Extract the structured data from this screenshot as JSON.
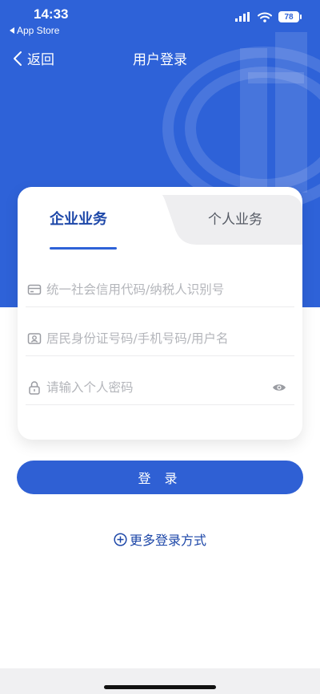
{
  "status_bar": {
    "time": "14:33",
    "back_app": "App Store",
    "battery": "78",
    "icons": [
      "signal-icon",
      "wifi-icon",
      "battery-icon"
    ]
  },
  "nav": {
    "back_label": "返回",
    "title": "用户登录"
  },
  "tabs": [
    {
      "label": "企业业务",
      "active": true
    },
    {
      "label": "个人业务",
      "active": false
    }
  ],
  "fields": {
    "credit_code": {
      "placeholder": "统一社会信用代码/纳税人识别号",
      "value": ""
    },
    "id_number": {
      "placeholder": "居民身份证号码/手机号码/用户名",
      "value": ""
    },
    "password": {
      "placeholder": "请输入个人密码",
      "value": ""
    }
  },
  "login_button": "登 录",
  "more_login": "更多登录方式",
  "colors": {
    "brand_blue": "#2e62d8",
    "dark_blue": "#1d47a8",
    "placeholder_gray": "#b4b6bb"
  }
}
